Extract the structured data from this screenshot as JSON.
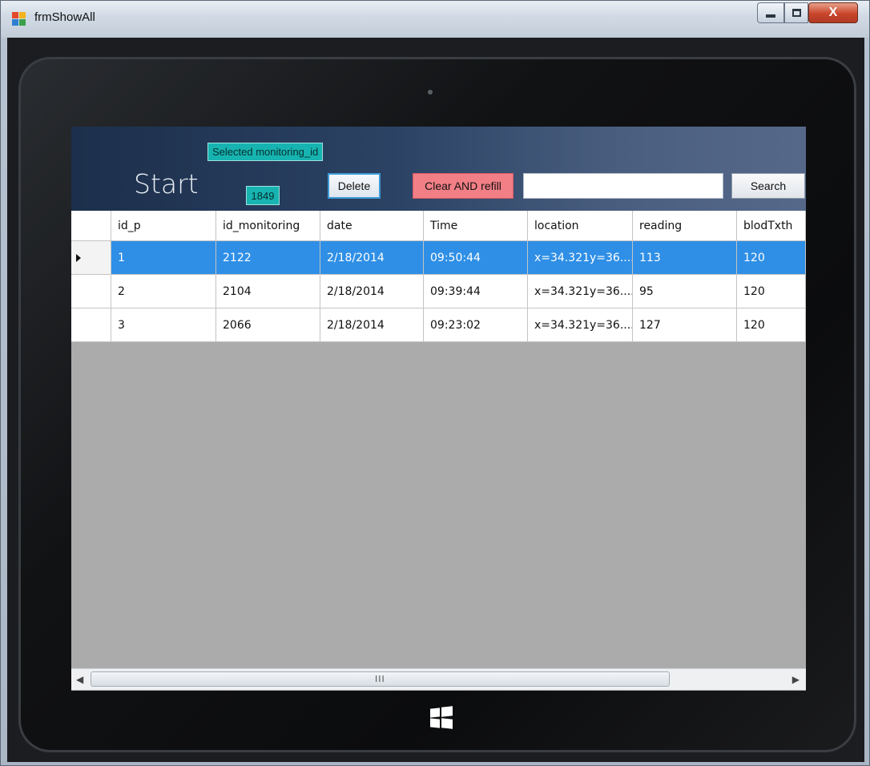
{
  "window": {
    "title": "frmShowAll"
  },
  "header": {
    "start_label": "Start",
    "selected_label": "Selected monitoring_id",
    "selected_value": "1849",
    "delete_label": "Delete",
    "clear_label": "Clear AND refill",
    "search_value": "",
    "search_label": "Search"
  },
  "grid": {
    "columns": [
      "id_p",
      "id_monitoring",
      "date",
      "Time",
      "location",
      "reading",
      "blodTxth"
    ],
    "rows": [
      [
        "1",
        "2122",
        "2/18/2014",
        "09:50:44",
        "x=34.321y=36....",
        "113",
        "120"
      ],
      [
        "2",
        "2104",
        "2/18/2014",
        "09:39:44",
        "x=34.321y=36....",
        "95",
        "120"
      ],
      [
        "3",
        "2066",
        "2/18/2014",
        "09:23:02",
        "x=34.321y=36....",
        "127",
        "120"
      ]
    ],
    "selected_row": 0
  },
  "scrollbar": {
    "grip": "III"
  },
  "colors": {
    "selection": "#2f8fe6",
    "clear_button": "#f27f86",
    "selected_badge": "#17b3b0"
  }
}
